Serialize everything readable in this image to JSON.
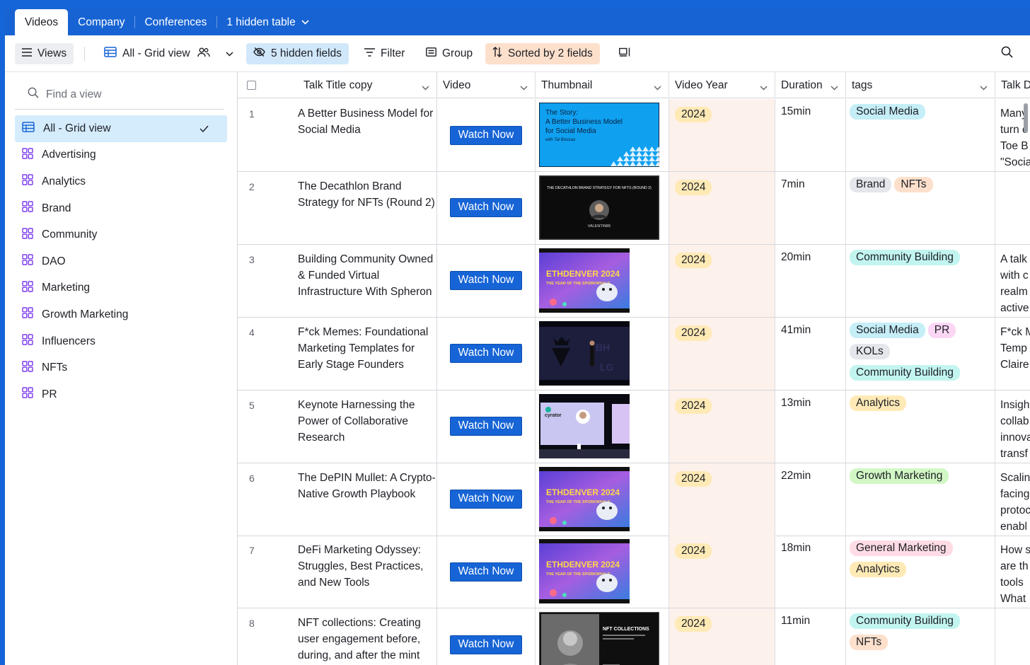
{
  "tabs": [
    {
      "label": "Videos"
    },
    {
      "label": "Company"
    },
    {
      "label": "Conferences"
    },
    {
      "label": "1 hidden table"
    }
  ],
  "toolbar": {
    "views_label": "Views",
    "view_name": "All - Grid view",
    "hidden_fields": "5 hidden fields",
    "filter": "Filter",
    "group": "Group",
    "sort": "Sorted by 2 fields"
  },
  "sidebar": {
    "find_placeholder": "Find a view",
    "views": [
      {
        "label": "All - Grid view",
        "active": true
      },
      {
        "label": "Advertising"
      },
      {
        "label": "Analytics"
      },
      {
        "label": "Brand"
      },
      {
        "label": "Community"
      },
      {
        "label": "DAO"
      },
      {
        "label": "Marketing"
      },
      {
        "label": "Growth Marketing"
      },
      {
        "label": "Influencers"
      },
      {
        "label": "NFTs"
      },
      {
        "label": "PR"
      }
    ]
  },
  "columns": [
    "Talk Title copy",
    "Video",
    "Thumbnail",
    "Video Year",
    "Duration",
    "tags",
    "Talk D"
  ],
  "watch_label": "Watch Now",
  "tag_colors": {
    "Social Media": "#c5eef7",
    "Brand": "#e4e6eb",
    "NFTs": "#fde0cc",
    "Community Building": "#c2f5ef",
    "PR": "#fbd7f5",
    "KOLs": "#e4e6eb",
    "Analytics": "#ffeab6",
    "Growth Marketing": "#d1f7c4",
    "General Marketing": "#ffdce5"
  },
  "rows": [
    {
      "num": "1",
      "title": "A Better Business Model for Social Media",
      "year": "2024",
      "duration": "15min",
      "tags": [
        "Social Media"
      ],
      "talk": [
        "Many",
        "turn c",
        "Toe B",
        "\"Socia"
      ],
      "thumb": "blue"
    },
    {
      "num": "2",
      "title": "The Decathlon Brand Strategy for NFTs (Round 2)",
      "year": "2024",
      "duration": "7min",
      "tags": [
        "Brand",
        "NFTs"
      ],
      "talk": [],
      "thumb": "dark"
    },
    {
      "num": "3",
      "title": "Building Community Owned & Funded Virtual Infrastructure With Spheron",
      "year": "2024",
      "duration": "20min",
      "tags": [
        "Community Building"
      ],
      "talk": [
        "A talk",
        "with c",
        "realm",
        "active"
      ],
      "thumb": "eth"
    },
    {
      "num": "4",
      "title": "F*ck Memes: Foundational Marketing Templates for Early Stage Founders",
      "year": "2024",
      "duration": "41min",
      "tags": [
        "Social Media",
        "PR",
        "KOLs",
        "Community Building"
      ],
      "talk": [
        "F*ck M",
        "Temp",
        "Claire"
      ],
      "thumb": "stage"
    },
    {
      "num": "5",
      "title": "Keynote Harnessing the Power of Collaborative Research",
      "year": "2024",
      "duration": "13min",
      "tags": [
        "Analytics"
      ],
      "talk": [
        "Insigh",
        "collab",
        "innova",
        "transf"
      ],
      "thumb": "cyrator"
    },
    {
      "num": "6",
      "title": "The DePIN Mullet: A Crypto-Native Growth Playbook",
      "year": "2024",
      "duration": "22min",
      "tags": [
        "Growth Marketing"
      ],
      "talk": [
        "Scalin",
        "facing",
        "protoc",
        "enabl"
      ],
      "thumb": "eth"
    },
    {
      "num": "7",
      "title": "DeFi Marketing Odyssey: Struggles, Best Practices, and New Tools",
      "year": "2024",
      "duration": "18min",
      "tags": [
        "General Marketing",
        "Analytics"
      ],
      "talk": [
        "How s",
        "are th",
        "tools",
        "What"
      ],
      "thumb": "eth"
    },
    {
      "num": "8",
      "title": "NFT collections: Creating user engagement before, during, and after the mint",
      "year": "2024",
      "duration": "11min",
      "tags": [
        "Community Building",
        "NFTs"
      ],
      "talk": [],
      "thumb": "nft"
    }
  ],
  "thumb_text": {
    "blue_a": "The Story:",
    "blue_b": "A Better Business Model",
    "blue_c": "for Social Media",
    "blue_d": "with Tal Bouzaa",
    "dark_a": "THE DECATHLON BRAND STRATEGY FOR NFTS (ROUND 2)",
    "dark_b": "VALENTIN85",
    "eth_a": "ETHDENVER 2024",
    "eth_b": "THE YEAR OF THE SPORKWHALE",
    "cyrator": "cyrator",
    "nft_a": "NFT COLLECTIONS"
  }
}
